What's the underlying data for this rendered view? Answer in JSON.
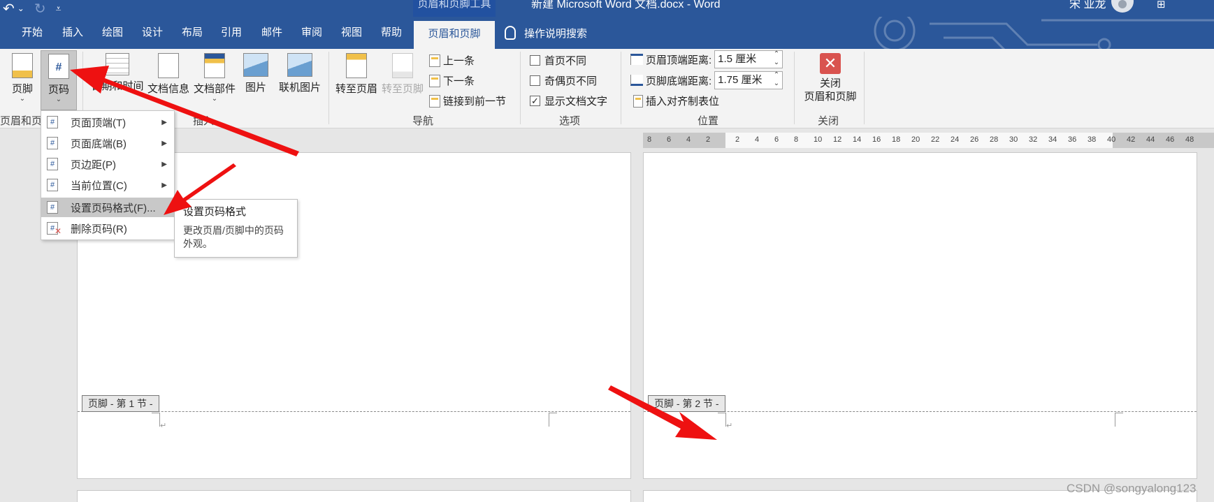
{
  "titlebar": {
    "undo_icon": "undo-icon",
    "redo_icon": "redo-icon",
    "customize_icon": "customize-qat-icon",
    "context_tools_label": "页眉和页脚工具",
    "document_title": "新建 Microsoft Word 文档.docx  -  Word",
    "user_name": "宋 业龙",
    "ribbon_display_icon": "ribbon-display-options-icon"
  },
  "tabs": [
    {
      "label": "开始"
    },
    {
      "label": "插入"
    },
    {
      "label": "绘图"
    },
    {
      "label": "设计"
    },
    {
      "label": "布局"
    },
    {
      "label": "引用"
    },
    {
      "label": "邮件"
    },
    {
      "label": "审阅"
    },
    {
      "label": "视图"
    },
    {
      "label": "帮助"
    },
    {
      "label": "页眉和页脚",
      "active": true
    }
  ],
  "search_label": "操作说明搜索",
  "ribbon": {
    "header_footer_group": {
      "footer_label": "页脚",
      "page_number_label": "页码",
      "group_label": "页眉和页脚"
    },
    "insert_group": {
      "datetime_label": "日期和时间",
      "docinfo_label": "文档信息",
      "quickparts_label": "文档部件",
      "picture_label": "图片",
      "online_picture_label": "联机图片",
      "group_label": "插入"
    },
    "nav_group": {
      "goto_header_label": "转至页眉",
      "goto_footer_label": "转至页脚",
      "previous_label": "上一条",
      "next_label": "下一条",
      "link_previous_label": "链接到前一节",
      "group_label": "导航"
    },
    "options_group": {
      "different_first_label": "首页不同",
      "different_first_checked": false,
      "different_odd_even_label": "奇偶页不同",
      "different_odd_even_checked": false,
      "show_doc_text_label": "显示文档文字",
      "show_doc_text_checked": true,
      "group_label": "选项"
    },
    "position_group": {
      "header_top_label": "页眉顶端距离:",
      "header_top_value": "1.5 厘米",
      "footer_bottom_label": "页脚底端距离:",
      "footer_bottom_value": "1.75 厘米",
      "insert_alignment_tab_label": "插入对齐制表位",
      "group_label": "位置"
    },
    "close_group": {
      "close_line1": "关闭",
      "close_line2": "页眉和页脚",
      "group_label": "关闭"
    }
  },
  "ruler": {
    "ticks": [
      "8",
      "6",
      "4",
      "2",
      "2",
      "4",
      "6",
      "8",
      "10",
      "12",
      "14",
      "16",
      "18",
      "20",
      "22",
      "24",
      "26",
      "28",
      "30",
      "32",
      "34",
      "36",
      "38",
      "40",
      "42",
      "44",
      "46",
      "48"
    ]
  },
  "page_number_menu": {
    "items": [
      {
        "label": "页面顶端(T)",
        "has_submenu": true
      },
      {
        "label": "页面底端(B)",
        "has_submenu": true
      },
      {
        "label": "页边距(P)",
        "has_submenu": true
      },
      {
        "label": "当前位置(C)",
        "has_submenu": true
      },
      {
        "label": "设置页码格式(F)...",
        "has_submenu": false,
        "hovered": true
      },
      {
        "label": "删除页码(R)",
        "has_submenu": false
      }
    ]
  },
  "tooltip": {
    "title": "设置页码格式",
    "description": "更改页眉/页脚中的页码外观。"
  },
  "pages": {
    "left_footer_tag": "页脚 - 第 1 节 -",
    "right_footer_tag": "页脚 - 第 2 节 -",
    "paragraph_mark": "↵"
  },
  "colors": {
    "accent": "#2b579a",
    "arrow": "#ee1111"
  },
  "watermark": "CSDN @songyalong123"
}
